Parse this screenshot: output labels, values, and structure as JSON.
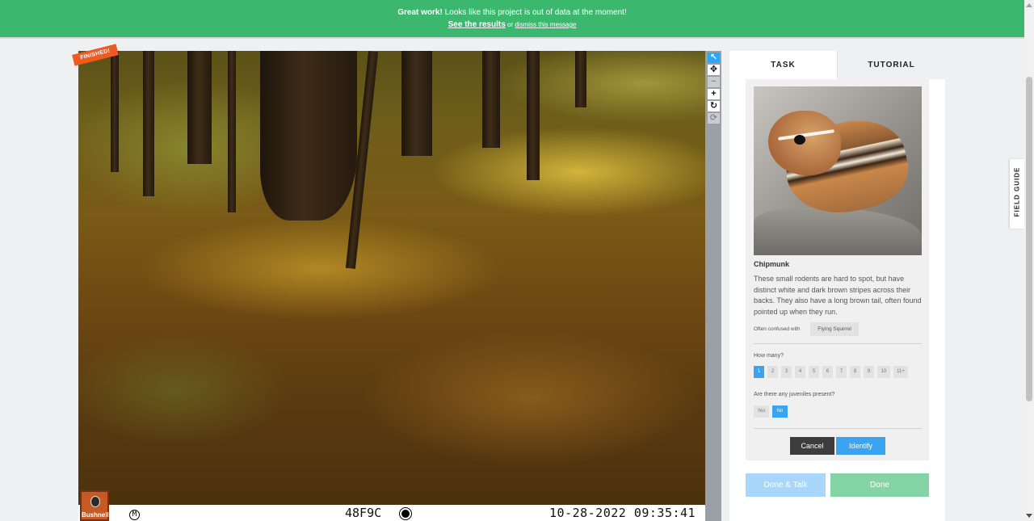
{
  "banner": {
    "bold": "Great work!",
    "message": " Looks like this project is out of data at the moment!",
    "results_link": "See the results",
    "or": " or ",
    "dismiss_link": "dismiss this message"
  },
  "subject": {
    "finished_ribbon": "FINISHED!",
    "camera_brand": "Bushnell",
    "camera_mode": "M",
    "camera_code": "48F9C",
    "timestamp": "10-28-2022 09:35:41"
  },
  "tools": [
    {
      "name": "pointer-icon",
      "glyph": "↖"
    },
    {
      "name": "pan-icon",
      "glyph": "✥"
    },
    {
      "name": "zoom-out-icon",
      "glyph": "−"
    },
    {
      "name": "zoom-in-icon",
      "glyph": "+"
    },
    {
      "name": "rotate-icon",
      "glyph": "↻"
    },
    {
      "name": "reset-icon",
      "glyph": "⟳"
    }
  ],
  "tabs": {
    "task": "TASK",
    "tutorial": "TUTORIAL"
  },
  "species_card": {
    "name": "Chipmunk",
    "description": "These small rodents are hard to spot, but have distinct white and dark brown stripes across their backs. They also have a long brown tail, often found pointed up when they run.",
    "confused_label": "Often confused with",
    "confused_with": "Flying Squirrel",
    "how_many_label": "How many?",
    "count_options": [
      "1",
      "2",
      "3",
      "4",
      "5",
      "6",
      "7",
      "8",
      "9",
      "10",
      "11+"
    ],
    "selected_count": "1",
    "juveniles_label": "Are there any juveniles present?",
    "yes_label": "Yes",
    "no_label": "No",
    "selected_juveniles": "No",
    "cancel_label": "Cancel",
    "identify_label": "Identify"
  },
  "actions": {
    "done_talk": "Done & Talk",
    "done": "Done"
  },
  "field_guide_label": "FIELD GUIDE",
  "colors": {
    "banner": "#3bb86e",
    "accent": "#3aa4f0",
    "finished": "#ef5a22",
    "done": "#84d4a6",
    "done_talk": "#a8d7fb"
  }
}
